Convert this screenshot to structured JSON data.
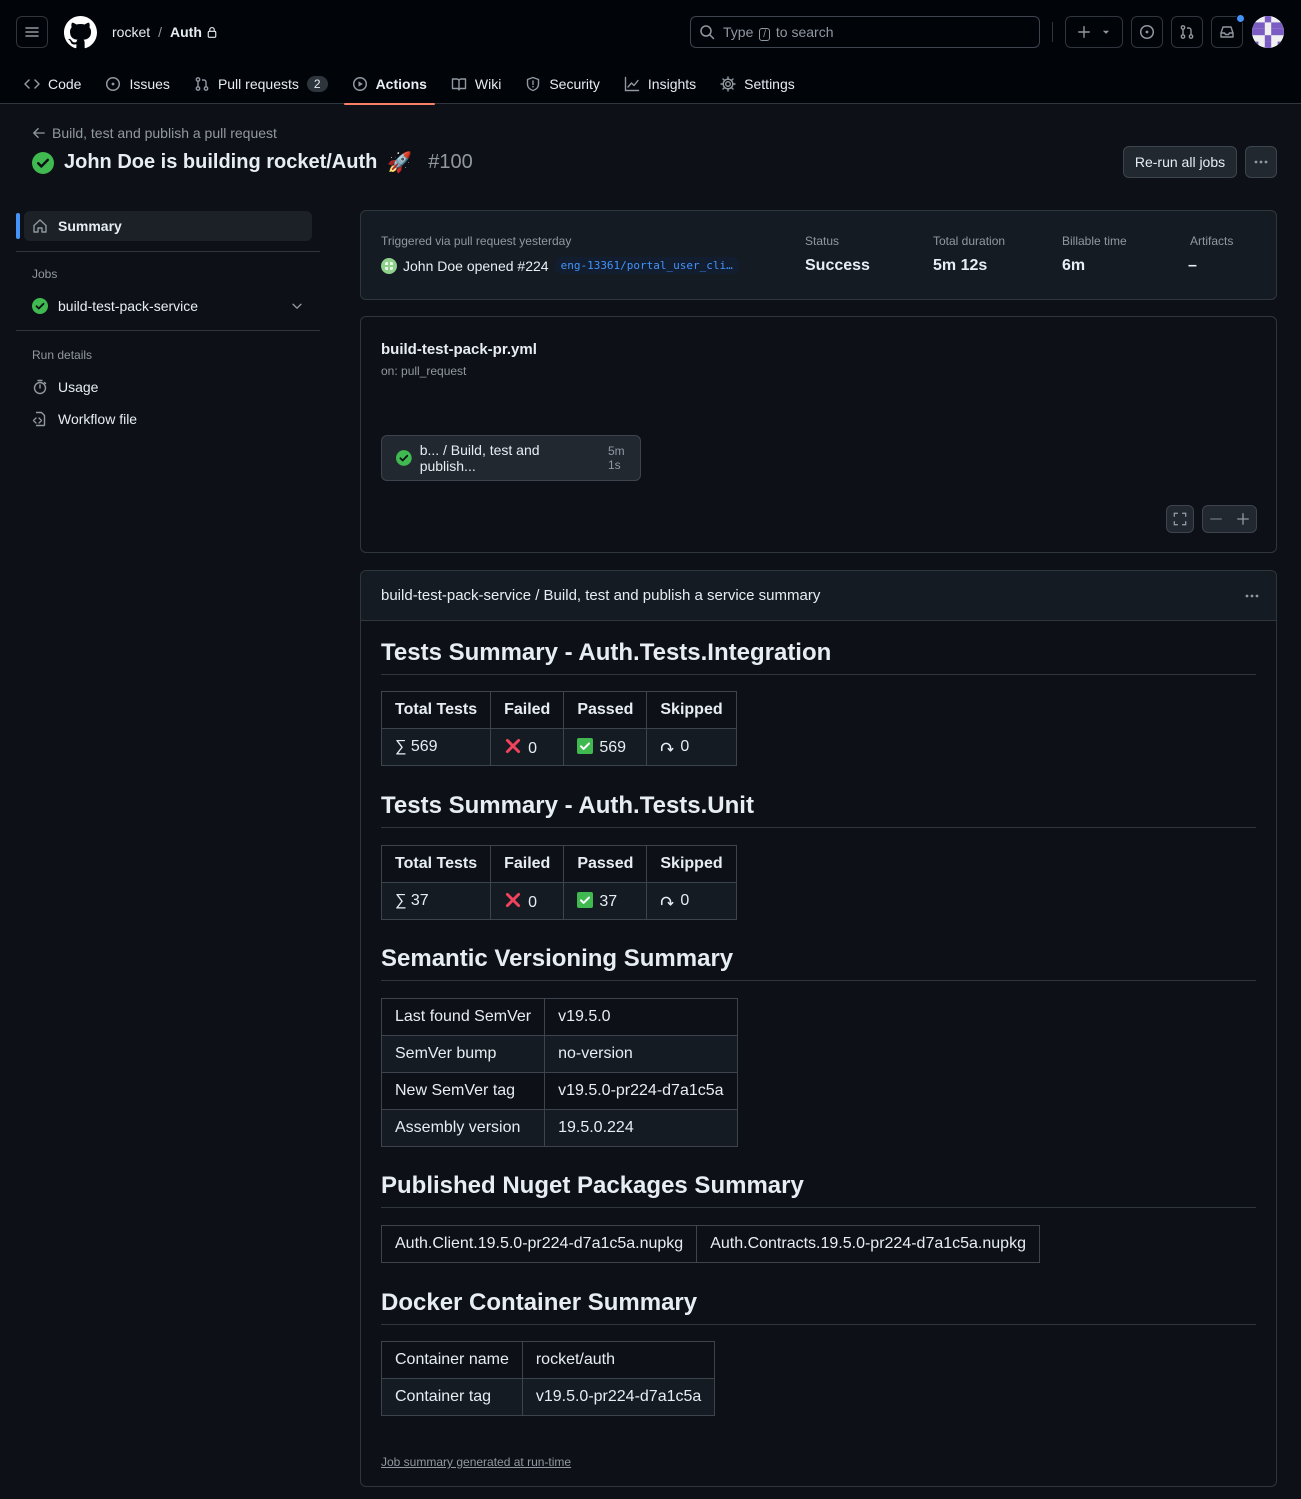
{
  "header": {
    "owner": "rocket",
    "separator": "/",
    "repo": "Auth",
    "search_prefix": "Type",
    "search_key": "/",
    "search_suffix": "to search"
  },
  "tabs": [
    {
      "label": "Code"
    },
    {
      "label": "Issues"
    },
    {
      "label": "Pull requests",
      "count": "2"
    },
    {
      "label": "Actions"
    },
    {
      "label": "Wiki"
    },
    {
      "label": "Security"
    },
    {
      "label": "Insights"
    },
    {
      "label": "Settings"
    }
  ],
  "run": {
    "back_label": "Build, test and publish a pull request",
    "title": "John Doe is building rocket/Auth",
    "emoji": "🚀",
    "number": "#100",
    "rerun_label": "Re-run all jobs"
  },
  "sidebar": {
    "summary_label": "Summary",
    "jobs_heading": "Jobs",
    "job_name": "build-test-pack-service",
    "run_details_heading": "Run details",
    "usage_label": "Usage",
    "workflow_file_label": "Workflow file"
  },
  "overview": {
    "trigger_label": "Triggered via pull request yesterday",
    "actor_text": "John Doe opened #224",
    "branch": "eng-13361/portal_user_cli…",
    "status_label": "Status",
    "status_value": "Success",
    "duration_label": "Total duration",
    "duration_value": "5m 12s",
    "billable_label": "Billable time",
    "billable_value": "6m",
    "artifacts_label": "Artifacts",
    "artifacts_value": "–"
  },
  "workflow": {
    "file": "build-test-pack-pr.yml",
    "trigger": "on: pull_request",
    "job_label": "b... / Build, test and publish...",
    "job_duration": "5m 1s"
  },
  "summary": {
    "header": "build-test-pack-service / Build, test and publish a service summary",
    "integration_title": "Tests Summary - Auth.Tests.Integration",
    "unit_title": "Tests Summary - Auth.Tests.Unit",
    "test_headers": [
      "Total Tests",
      "Failed",
      "Passed",
      "Skipped"
    ],
    "integration": {
      "total": "∑ 569",
      "failed": "0",
      "passed": "569",
      "skipped": "0"
    },
    "unit": {
      "total": "∑ 37",
      "failed": "0",
      "passed": "37",
      "skipped": "0"
    },
    "semver_title": "Semantic Versioning Summary",
    "semver_rows": [
      {
        "k": "Last found SemVer",
        "v": "v19.5.0"
      },
      {
        "k": "SemVer bump",
        "v": "no-version"
      },
      {
        "k": "New SemVer tag",
        "v": "v19.5.0-pr224-d7a1c5a"
      },
      {
        "k": "Assembly version",
        "v": "19.5.0.224"
      }
    ],
    "nuget_title": "Published Nuget Packages Summary",
    "nuget_packages": [
      "Auth.Client.19.5.0-pr224-d7a1c5a.nupkg",
      "Auth.Contracts.19.5.0-pr224-d7a1c5a.nupkg"
    ],
    "docker_title": "Docker Container Summary",
    "docker_rows": [
      {
        "k": "Container name",
        "v": "rocket/auth"
      },
      {
        "k": "Container tag",
        "v": "v19.5.0-pr224-d7a1c5a"
      }
    ],
    "footnote": "Job summary generated at run-time"
  },
  "colors": {
    "success": "#3fb950",
    "accent": "#4493f8",
    "tab_underline": "#f78166",
    "fail": "#f85149"
  }
}
